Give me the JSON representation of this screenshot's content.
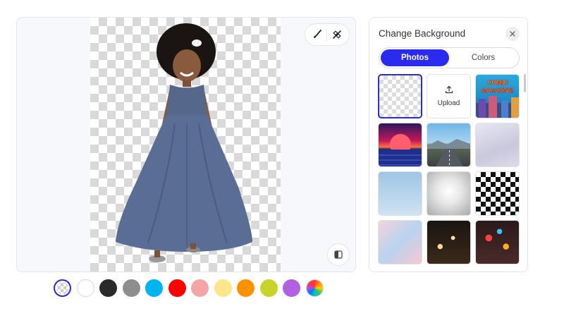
{
  "canvas": {
    "tools": {
      "brush_icon": "brush-icon",
      "eraser_icon": "magic-eraser-icon"
    },
    "compare_icon": "compare-icon"
  },
  "color_swatches": [
    {
      "name": "transparent",
      "color": "transparent",
      "selected": true
    },
    {
      "name": "white",
      "color": "#ffffff"
    },
    {
      "name": "black",
      "color": "#2b2b2b"
    },
    {
      "name": "gray",
      "color": "#8e8e8e"
    },
    {
      "name": "sky-blue",
      "color": "#00b4f0"
    },
    {
      "name": "red",
      "color": "#ff0000"
    },
    {
      "name": "pink",
      "color": "#f4a6a6"
    },
    {
      "name": "light-yellow",
      "color": "#fbe68a"
    },
    {
      "name": "orange",
      "color": "#ff9000"
    },
    {
      "name": "lime",
      "color": "#c8d42a"
    },
    {
      "name": "purple",
      "color": "#b060e0"
    },
    {
      "name": "rainbow",
      "color": "conic"
    }
  ],
  "side_panel": {
    "title": "Change Background",
    "tabs": [
      {
        "label": "Photos",
        "active": true
      },
      {
        "label": "Colors",
        "active": false
      }
    ],
    "upload_label": "Upload",
    "comic_text": "COMIC MAGAZINE!",
    "tiles": [
      "transparent",
      "upload",
      "comic",
      "sunset",
      "road",
      "studio",
      "sky",
      "radial",
      "checker-warp",
      "clouds",
      "bokeh",
      "rain-lights"
    ]
  }
}
